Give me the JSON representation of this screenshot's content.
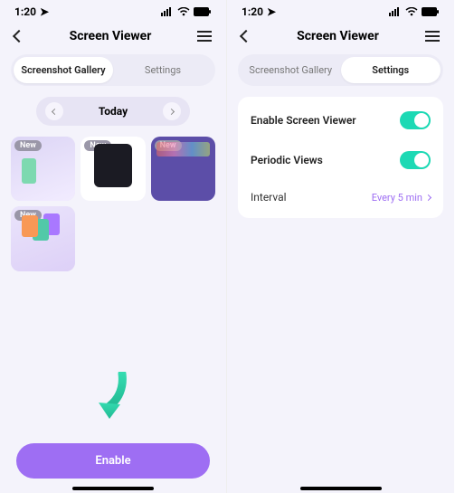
{
  "status": {
    "time": "1:20",
    "loc_glyph": "➤"
  },
  "header": {
    "title": "Screen Viewer"
  },
  "tabs": {
    "gallery": "Screenshot Gallery",
    "settings": "Settings"
  },
  "date": {
    "label": "Today"
  },
  "gallery": {
    "badge": "New",
    "items": [
      {
        "name": "thumb-1"
      },
      {
        "name": "thumb-2"
      },
      {
        "name": "thumb-3"
      },
      {
        "name": "thumb-4"
      }
    ]
  },
  "cta": {
    "enable": "Enable"
  },
  "settings": {
    "enable_label": "Enable Screen Viewer",
    "periodic_label": "Periodic Views",
    "interval_label": "Interval",
    "interval_value": "Every 5 min"
  }
}
